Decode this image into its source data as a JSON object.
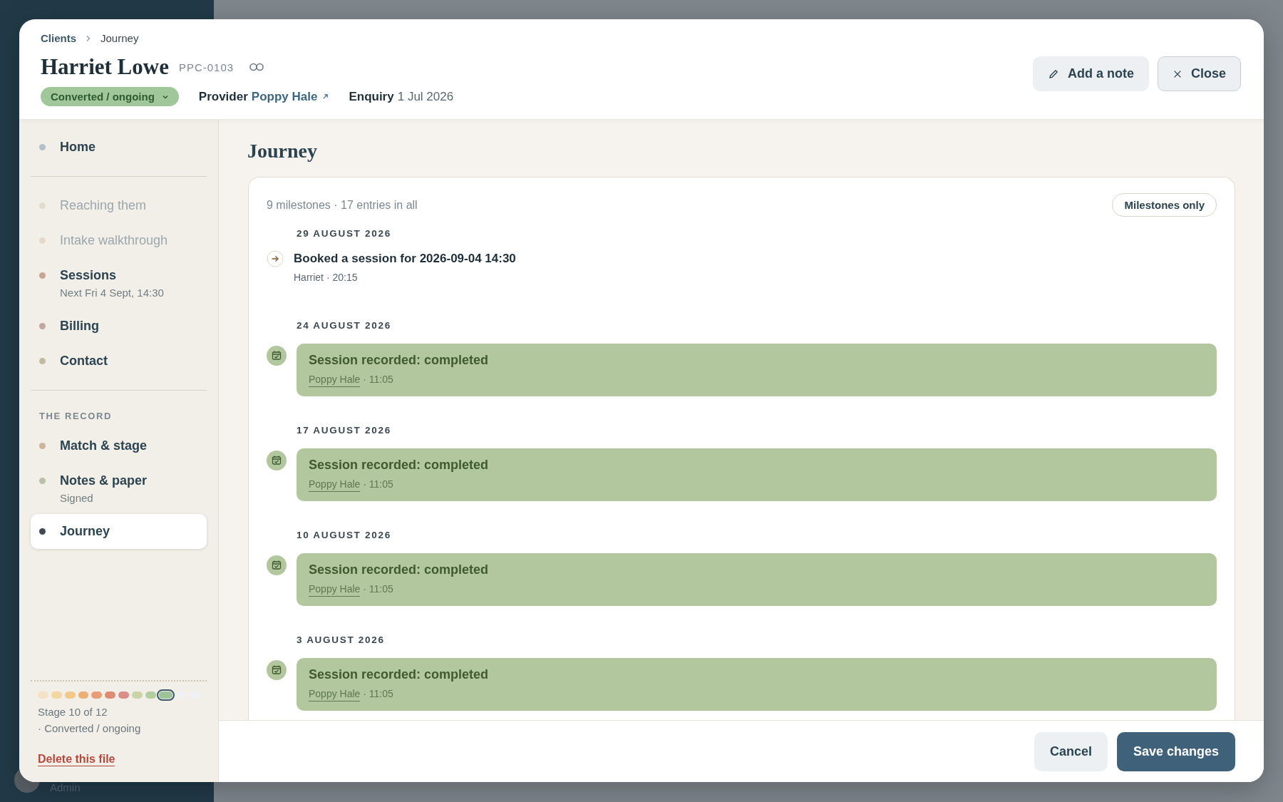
{
  "background": {
    "user_role": "Admin"
  },
  "breadcrumb": [
    {
      "label": "Clients"
    },
    {
      "label": "Journey"
    }
  ],
  "client": {
    "name": "Harriet Lowe",
    "code": "PPC-0103",
    "status": "Converted / ongoing",
    "provider_label": "Provider",
    "provider": "Poppy Hale",
    "enquiry_label": "Enquiry",
    "enquiry": "1 Jul 2026"
  },
  "header_buttons": [
    {
      "kind": "note",
      "label": "Add a note"
    },
    {
      "kind": "close",
      "label": "Close"
    }
  ],
  "sidebar": {
    "groups": [
      {
        "items": [
          {
            "label": "Home",
            "color": "#b4c0c9",
            "disabled": false,
            "selected": false
          }
        ]
      },
      {
        "items": [
          {
            "label": "Reaching them",
            "color": "#e2dccf",
            "disabled": true,
            "selected": false
          },
          {
            "label": "Intake walkthrough",
            "color": "#e6d9cb",
            "disabled": true,
            "selected": false
          },
          {
            "label": "Sessions",
            "sub": "Next Fri 4 Sept, 14:30",
            "color": "#c9a495",
            "disabled": false,
            "selected": false
          },
          {
            "label": "Billing",
            "color": "#c4a4a0",
            "disabled": false,
            "selected": false
          },
          {
            "label": "Contact",
            "color": "#c2bb9f",
            "disabled": false,
            "selected": false
          }
        ]
      },
      {
        "heading": "THE RECORD",
        "items": [
          {
            "label": "Match & stage",
            "color": "#cfb39c",
            "disabled": false,
            "selected": false
          },
          {
            "label": "Notes & paper",
            "sub": "Signed",
            "color": "#b9c0a8",
            "disabled": false,
            "selected": false
          },
          {
            "label": "Journey",
            "color": "#3e4a55",
            "disabled": false,
            "selected": true
          }
        ]
      }
    ],
    "stages": [
      {
        "color": "#f3e2c8",
        "selected": false
      },
      {
        "color": "#f4d6a0",
        "selected": false
      },
      {
        "color": "#f1c98a",
        "selected": false
      },
      {
        "color": "#ecb077",
        "selected": false
      },
      {
        "color": "#e79e76",
        "selected": false
      },
      {
        "color": "#e08c74",
        "selected": false
      },
      {
        "color": "#dc8d86",
        "selected": false
      },
      {
        "color": "#c9d4a9",
        "selected": false
      },
      {
        "color": "#b5cc9e",
        "selected": false
      },
      {
        "color": "#9dc499",
        "selected": true
      },
      {
        "color": "#eef0f3",
        "selected": false
      },
      {
        "color": "#eef0f3",
        "selected": false
      }
    ],
    "stage_text": "Stage 10 of 12",
    "stage_status": "· Converted / ongoing",
    "delete_link": "Delete this file"
  },
  "journey": {
    "title": "Journey",
    "summary": "9 milestones · 17 entries in all",
    "filter": {
      "label": "Milestones only",
      "on": false
    },
    "entries": [
      {
        "kind": "event",
        "date": "29 AUGUST 2026",
        "title": "Booked a session for 2026-09-04 14:30",
        "author": "Harriet",
        "time": "· 20:15"
      },
      {
        "kind": "milestone",
        "date": "24 AUGUST 2026",
        "title": "Session recorded: completed",
        "author": "Poppy Hale",
        "time": "· 11:05"
      },
      {
        "kind": "milestone",
        "date": "17 AUGUST 2026",
        "title": "Session recorded: completed",
        "author": "Poppy Hale",
        "time": "· 11:05"
      },
      {
        "kind": "milestone",
        "date": "10 AUGUST 2026",
        "title": "Session recorded: completed",
        "author": "Poppy Hale",
        "time": "· 11:05"
      },
      {
        "kind": "milestone",
        "date": "3 AUGUST 2026",
        "title": "Session recorded: completed",
        "author": "Poppy Hale",
        "time": "· 11:05"
      }
    ]
  },
  "footer_buttons": [
    {
      "kind": "secondary",
      "label": "Cancel"
    },
    {
      "kind": "primary",
      "label": "Save changes"
    }
  ]
}
